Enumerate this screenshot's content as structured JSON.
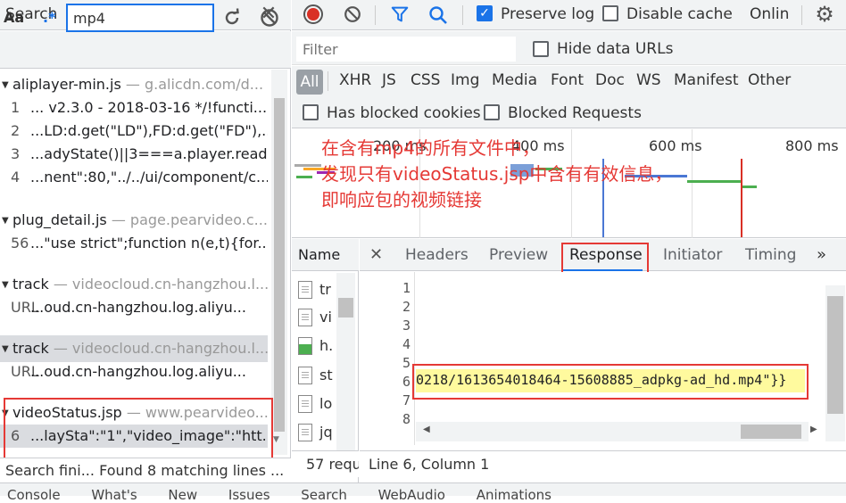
{
  "search_panel": {
    "title": "Search",
    "match_case_label": "Aa",
    "regex_label": ".*",
    "query": "mp4",
    "results": [
      {
        "file": "aliplayer-min.js",
        "source": "— g.alicdn.com/d...",
        "lines": [
          {
            "num": "1",
            "text": "... v2.3.0 - 2018-03-16 */!functi..."
          },
          {
            "num": "2",
            "text": "...LD:d.get(\"LD\"),FD:d.get(\"FD\"),..."
          },
          {
            "num": "3",
            "text": "...adyState()||3===a.player.read..."
          },
          {
            "num": "4",
            "text": "...nent\":80,\"../../ui/component/c..."
          }
        ]
      },
      {
        "file": "plug_detail.js",
        "source": "— page.pearvideo.c...",
        "lines": [
          {
            "num": "56",
            "text": "...\"use strict\";function n(e,t){for..."
          }
        ]
      },
      {
        "file": "track",
        "source": "— videocloud.cn-hangzhou.l...",
        "lines": [
          {
            "num": "URL",
            "text": "...oud.cn-hangzhou.log.aliyu..."
          }
        ]
      },
      {
        "file": "track",
        "source": "— videocloud.cn-hangzhou.l...",
        "lines": [
          {
            "num": "URL",
            "text": "...oud.cn-hangzhou.log.aliyu..."
          }
        ]
      },
      {
        "file": "videoStatus.jsp",
        "source": "— www.pearvideo...",
        "lines": [
          {
            "num": "6",
            "text": "...laySta\":\"1\",\"video_image\":\"htt..."
          }
        ]
      }
    ],
    "status": "Search fini...   Found 8 matching lines ..."
  },
  "toolbar": {
    "preserve_log": "Preserve log",
    "preserve_log_checked": true,
    "disable_cache": "Disable cache",
    "disable_cache_checked": false,
    "throttling": "Onlin"
  },
  "filter": {
    "placeholder": "Filter",
    "hide_data_urls": "Hide data URLs",
    "types": [
      "All",
      "XHR",
      "JS",
      "CSS",
      "Img",
      "Media",
      "Font",
      "Doc",
      "WS",
      "Manifest",
      "Other"
    ],
    "active_type": "All",
    "has_blocked_cookies": "Has blocked cookies",
    "blocked_requests": "Blocked Requests"
  },
  "timeline": {
    "ticks": [
      "200 ms",
      "400 ms",
      "600 ms",
      "800 ms"
    ]
  },
  "annotation": {
    "text": "在含有mp4的所有文件中，\n发现只有videoStatus.jsp中含有有效信息，\n即响应包的视频链接",
    "color": "#e53935"
  },
  "requests": {
    "header": "Name",
    "items": [
      {
        "icon": "doc-icon",
        "name": "tr"
      },
      {
        "icon": "doc-icon",
        "name": "vi"
      },
      {
        "icon": "image-icon",
        "name": "h."
      },
      {
        "icon": "doc-icon",
        "name": "st"
      },
      {
        "icon": "doc-icon",
        "name": "lo"
      },
      {
        "icon": "doc-icon",
        "name": "jq"
      }
    ],
    "count": "57 requ"
  },
  "detail": {
    "tabs": [
      "Headers",
      "Preview",
      "Response",
      "Initiator",
      "Timing"
    ],
    "active_tab": "Response",
    "line_numbers": [
      "1",
      "2",
      "3",
      "4",
      "5",
      "6",
      "7",
      "8"
    ],
    "highlighted_line": "6",
    "code": "0218/1613654018464-15608885_adpkg-ad_hd.mp4\"}}",
    "cursor": "Line 6, Column 1"
  },
  "drawer": {
    "text": "Console What's New Issues Search WebAudio Animations"
  },
  "colors": {
    "accent": "#1a73e8",
    "record": "#d93025",
    "highlight_box": "#e53935",
    "code_highlight": "#fffa9e"
  }
}
